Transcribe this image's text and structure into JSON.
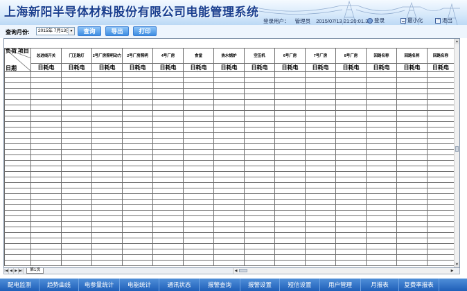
{
  "header": {
    "title": "上海新阳半导体材料股份有限公司电能管理系统",
    "login_label": "登录用户：",
    "login_user": "管理员",
    "datetime": "2015/07/13  21:20:01.3",
    "login_btn": "登录",
    "minimize_btn": "最小化",
    "exit_btn": "退出"
  },
  "query": {
    "label": "查询月份:",
    "date_value": "2015年 7月13日",
    "buttons": [
      "查询",
      "导出",
      "打印"
    ]
  },
  "grid": {
    "corner": {
      "load": "负荷",
      "item": "项目",
      "date": "日期"
    },
    "columns": [
      "总进线开关",
      "门卫路灯",
      "2号厂房照明动力",
      "2号厂房照明",
      "4号厂房",
      "食堂",
      "热水锅炉",
      "空压机",
      "6号厂房",
      "7号厂房",
      "8号厂房",
      "回路名称",
      "回路名称",
      "回路名称"
    ],
    "unit": "日耗电",
    "row_count": 35
  },
  "sheet": {
    "tab": "第1页"
  },
  "bottom_nav": [
    "配电监测",
    "趋势曲线",
    "电参量统计",
    "电能统计",
    "通讯状态",
    "报警查询",
    "报警设置",
    "短信设置",
    "用户管理",
    "月报表",
    "复费率报表"
  ],
  "colors": {
    "title": "#1a3f8f",
    "nav_bg": "#2f73c8",
    "button": "#3d8de2"
  }
}
